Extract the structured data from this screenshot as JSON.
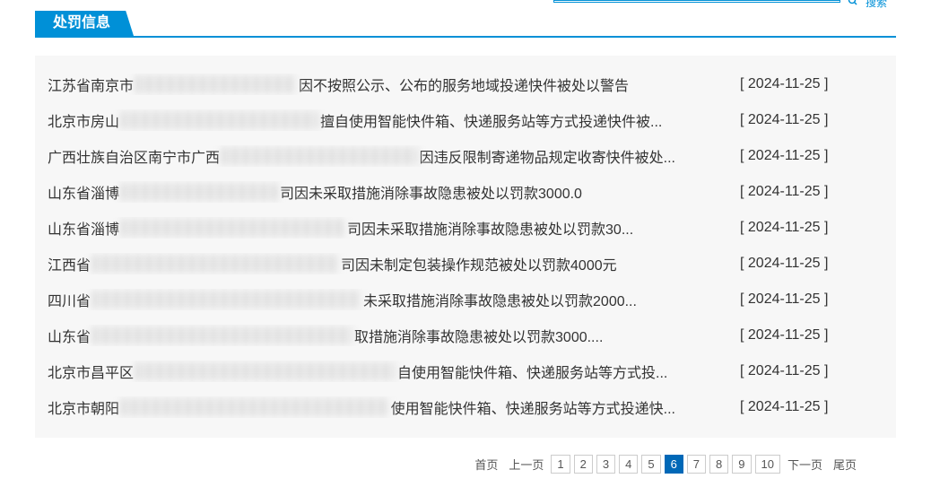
{
  "search": {
    "label": "搜索"
  },
  "section": {
    "title": "处罚信息"
  },
  "items": [
    {
      "prefix": "江苏省南京市",
      "redact_w": 180,
      "suffix": "因不按照公示、公布的服务地域投递快件被处以警告",
      "date": "[ 2024-11-25 ]"
    },
    {
      "prefix": "北京市房山",
      "redact_w": 220,
      "suffix": "擅自使用智能快件箱、快递服务站等方式投递快件被...",
      "date": "[ 2024-11-25 ]"
    },
    {
      "prefix": "广西壮族自治区南宁市广西",
      "redact_w": 220,
      "suffix": "因违反限制寄递物品规定收寄快件被处...",
      "date": "[ 2024-11-25 ]"
    },
    {
      "prefix": "山东省淄博",
      "redact_w": 175,
      "suffix": "司因未采取措施消除事故隐患被处以罚款3000.0",
      "date": "[ 2024-11-25 ]"
    },
    {
      "prefix": "山东省淄博",
      "redact_w": 250,
      "suffix": "司因未采取措施消除事故隐患被处以罚款30...",
      "date": "[ 2024-11-25 ]"
    },
    {
      "prefix": "江西省",
      "redact_w": 275,
      "suffix": "司因未制定包装操作规范被处以罚款4000元",
      "date": "[ 2024-11-25 ]"
    },
    {
      "prefix": "四川省",
      "redact_w": 300,
      "suffix": "未采取措施消除事故隐患被处以罚款2000...",
      "date": "[ 2024-11-25 ]"
    },
    {
      "prefix": "山东省",
      "redact_w": 290,
      "suffix": "取措施消除事故隐患被处以罚款3000....",
      "date": "[ 2024-11-25 ]"
    },
    {
      "prefix": "北京市昌平区",
      "redact_w": 290,
      "suffix": "自使用智能快件箱、快递服务站等方式投...",
      "date": "[ 2024-11-25 ]"
    },
    {
      "prefix": "北京市朝阳",
      "redact_w": 310,
      "suffix": "使用智能快件箱、快递服务站等方式投递快...",
      "date": "[ 2024-11-25 ]"
    }
  ],
  "pager": {
    "first": "首页",
    "prev": "上一页",
    "next": "下一页",
    "last": "尾页",
    "pages": [
      "1",
      "2",
      "3",
      "4",
      "5",
      "6",
      "7",
      "8",
      "9",
      "10"
    ],
    "current": "6"
  }
}
